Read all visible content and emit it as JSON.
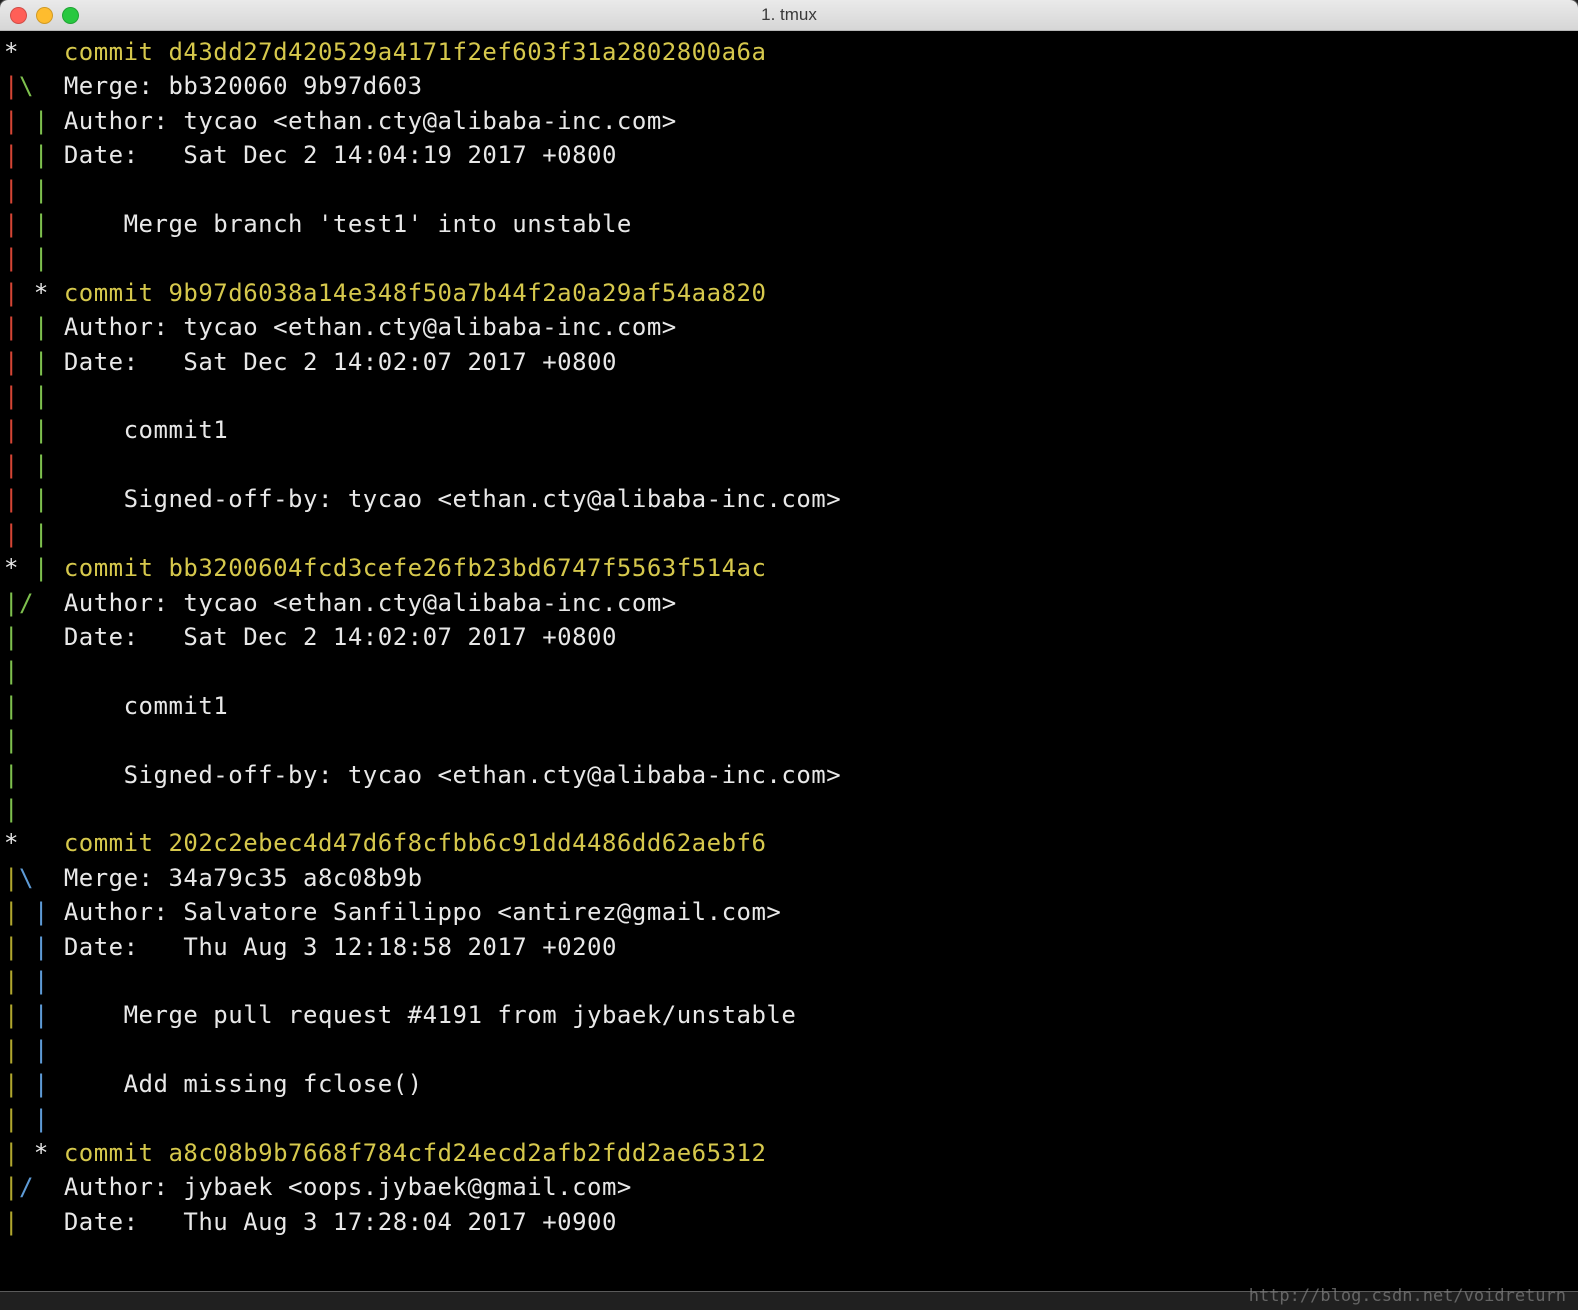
{
  "window": {
    "title": "1. tmux"
  },
  "watermark": "http://blog.csdn.net/voidreturn",
  "colors": {
    "red": "#d54535",
    "green": "#7ec04e",
    "yellow": "#d6c84c",
    "olive": "#b0a72e",
    "blue": "#5e9bd6",
    "white": "#e8e8e8"
  },
  "lines": [
    {
      "graph": [
        {
          "t": "*",
          "c": "white"
        },
        {
          "t": "   ",
          "c": "white"
        }
      ],
      "segs": [
        {
          "t": "commit d43dd27d420529a4171f2ef603f31a2802800a6a",
          "c": "yellow"
        }
      ]
    },
    {
      "graph": [
        {
          "t": "|",
          "c": "red"
        },
        {
          "t": "\\",
          "c": "green"
        },
        {
          "t": "  ",
          "c": "white"
        }
      ],
      "segs": [
        {
          "t": "Merge: bb320060 9b97d603",
          "c": "white"
        }
      ]
    },
    {
      "graph": [
        {
          "t": "|",
          "c": "red"
        },
        {
          "t": " ",
          "c": "white"
        },
        {
          "t": "|",
          "c": "green"
        },
        {
          "t": " ",
          "c": "white"
        }
      ],
      "segs": [
        {
          "t": "Author: tycao <ethan.cty@alibaba-inc.com>",
          "c": "white"
        }
      ]
    },
    {
      "graph": [
        {
          "t": "|",
          "c": "red"
        },
        {
          "t": " ",
          "c": "white"
        },
        {
          "t": "|",
          "c": "green"
        },
        {
          "t": " ",
          "c": "white"
        }
      ],
      "segs": [
        {
          "t": "Date:   Sat Dec 2 14:04:19 2017 +0800",
          "c": "white"
        }
      ]
    },
    {
      "graph": [
        {
          "t": "|",
          "c": "red"
        },
        {
          "t": " ",
          "c": "white"
        },
        {
          "t": "|",
          "c": "green"
        },
        {
          "t": " ",
          "c": "white"
        }
      ],
      "segs": []
    },
    {
      "graph": [
        {
          "t": "|",
          "c": "red"
        },
        {
          "t": " ",
          "c": "white"
        },
        {
          "t": "|",
          "c": "green"
        },
        {
          "t": " ",
          "c": "white"
        }
      ],
      "segs": [
        {
          "t": "    Merge branch 'test1' into unstable",
          "c": "white"
        }
      ]
    },
    {
      "graph": [
        {
          "t": "|",
          "c": "red"
        },
        {
          "t": " ",
          "c": "white"
        },
        {
          "t": "|",
          "c": "green"
        },
        {
          "t": " ",
          "c": "white"
        }
      ],
      "segs": []
    },
    {
      "graph": [
        {
          "t": "|",
          "c": "red"
        },
        {
          "t": " ",
          "c": "white"
        },
        {
          "t": "*",
          "c": "white"
        },
        {
          "t": " ",
          "c": "white"
        }
      ],
      "segs": [
        {
          "t": "commit 9b97d6038a14e348f50a7b44f2a0a29af54aa820",
          "c": "yellow"
        }
      ]
    },
    {
      "graph": [
        {
          "t": "|",
          "c": "red"
        },
        {
          "t": " ",
          "c": "white"
        },
        {
          "t": "|",
          "c": "green"
        },
        {
          "t": " ",
          "c": "white"
        }
      ],
      "segs": [
        {
          "t": "Author: tycao <ethan.cty@alibaba-inc.com>",
          "c": "white"
        }
      ]
    },
    {
      "graph": [
        {
          "t": "|",
          "c": "red"
        },
        {
          "t": " ",
          "c": "white"
        },
        {
          "t": "|",
          "c": "green"
        },
        {
          "t": " ",
          "c": "white"
        }
      ],
      "segs": [
        {
          "t": "Date:   Sat Dec 2 14:02:07 2017 +0800",
          "c": "white"
        }
      ]
    },
    {
      "graph": [
        {
          "t": "|",
          "c": "red"
        },
        {
          "t": " ",
          "c": "white"
        },
        {
          "t": "|",
          "c": "green"
        },
        {
          "t": " ",
          "c": "white"
        }
      ],
      "segs": []
    },
    {
      "graph": [
        {
          "t": "|",
          "c": "red"
        },
        {
          "t": " ",
          "c": "white"
        },
        {
          "t": "|",
          "c": "green"
        },
        {
          "t": " ",
          "c": "white"
        }
      ],
      "segs": [
        {
          "t": "    commit1",
          "c": "white"
        }
      ]
    },
    {
      "graph": [
        {
          "t": "|",
          "c": "red"
        },
        {
          "t": " ",
          "c": "white"
        },
        {
          "t": "|",
          "c": "green"
        },
        {
          "t": " ",
          "c": "white"
        }
      ],
      "segs": []
    },
    {
      "graph": [
        {
          "t": "|",
          "c": "red"
        },
        {
          "t": " ",
          "c": "white"
        },
        {
          "t": "|",
          "c": "green"
        },
        {
          "t": " ",
          "c": "white"
        }
      ],
      "segs": [
        {
          "t": "    Signed-off-by: tycao <ethan.cty@alibaba-inc.com>",
          "c": "white"
        }
      ]
    },
    {
      "graph": [
        {
          "t": "|",
          "c": "red"
        },
        {
          "t": " ",
          "c": "white"
        },
        {
          "t": "|",
          "c": "green"
        },
        {
          "t": " ",
          "c": "white"
        }
      ],
      "segs": []
    },
    {
      "graph": [
        {
          "t": "*",
          "c": "white"
        },
        {
          "t": " ",
          "c": "white"
        },
        {
          "t": "|",
          "c": "green"
        },
        {
          "t": " ",
          "c": "white"
        }
      ],
      "segs": [
        {
          "t": "commit bb3200604fcd3cefe26fb23bd6747f5563f514ac",
          "c": "yellow"
        }
      ]
    },
    {
      "graph": [
        {
          "t": "|",
          "c": "green"
        },
        {
          "t": "/",
          "c": "green"
        },
        {
          "t": "  ",
          "c": "white"
        }
      ],
      "segs": [
        {
          "t": "Author: tycao <ethan.cty@alibaba-inc.com>",
          "c": "white"
        }
      ]
    },
    {
      "graph": [
        {
          "t": "|",
          "c": "green"
        },
        {
          "t": "   ",
          "c": "white"
        }
      ],
      "segs": [
        {
          "t": "Date:   Sat Dec 2 14:02:07 2017 +0800",
          "c": "white"
        }
      ]
    },
    {
      "graph": [
        {
          "t": "|",
          "c": "green"
        },
        {
          "t": "   ",
          "c": "white"
        }
      ],
      "segs": []
    },
    {
      "graph": [
        {
          "t": "|",
          "c": "green"
        },
        {
          "t": "   ",
          "c": "white"
        }
      ],
      "segs": [
        {
          "t": "    commit1",
          "c": "white"
        }
      ]
    },
    {
      "graph": [
        {
          "t": "|",
          "c": "green"
        },
        {
          "t": "   ",
          "c": "white"
        }
      ],
      "segs": []
    },
    {
      "graph": [
        {
          "t": "|",
          "c": "green"
        },
        {
          "t": "   ",
          "c": "white"
        }
      ],
      "segs": [
        {
          "t": "    Signed-off-by: tycao <ethan.cty@alibaba-inc.com>",
          "c": "white"
        }
      ]
    },
    {
      "graph": [
        {
          "t": "|",
          "c": "green"
        },
        {
          "t": "   ",
          "c": "white"
        }
      ],
      "segs": []
    },
    {
      "graph": [
        {
          "t": "*",
          "c": "white"
        },
        {
          "t": "   ",
          "c": "white"
        }
      ],
      "segs": [
        {
          "t": "commit 202c2ebec4d47d6f8cfbb6c91dd4486dd62aebf6",
          "c": "yellow"
        }
      ]
    },
    {
      "graph": [
        {
          "t": "|",
          "c": "olive"
        },
        {
          "t": "\\",
          "c": "blue"
        },
        {
          "t": "  ",
          "c": "white"
        }
      ],
      "segs": [
        {
          "t": "Merge: 34a79c35 a8c08b9b",
          "c": "white"
        }
      ]
    },
    {
      "graph": [
        {
          "t": "|",
          "c": "olive"
        },
        {
          "t": " ",
          "c": "white"
        },
        {
          "t": "|",
          "c": "blue"
        },
        {
          "t": " ",
          "c": "white"
        }
      ],
      "segs": [
        {
          "t": "Author: Salvatore Sanfilippo <antirez@gmail.com>",
          "c": "white"
        }
      ]
    },
    {
      "graph": [
        {
          "t": "|",
          "c": "olive"
        },
        {
          "t": " ",
          "c": "white"
        },
        {
          "t": "|",
          "c": "blue"
        },
        {
          "t": " ",
          "c": "white"
        }
      ],
      "segs": [
        {
          "t": "Date:   Thu Aug 3 12:18:58 2017 +0200",
          "c": "white"
        }
      ]
    },
    {
      "graph": [
        {
          "t": "|",
          "c": "olive"
        },
        {
          "t": " ",
          "c": "white"
        },
        {
          "t": "|",
          "c": "blue"
        },
        {
          "t": " ",
          "c": "white"
        }
      ],
      "segs": []
    },
    {
      "graph": [
        {
          "t": "|",
          "c": "olive"
        },
        {
          "t": " ",
          "c": "white"
        },
        {
          "t": "|",
          "c": "blue"
        },
        {
          "t": " ",
          "c": "white"
        }
      ],
      "segs": [
        {
          "t": "    Merge pull request #4191 from jybaek/unstable",
          "c": "white"
        }
      ]
    },
    {
      "graph": [
        {
          "t": "|",
          "c": "olive"
        },
        {
          "t": " ",
          "c": "white"
        },
        {
          "t": "|",
          "c": "blue"
        },
        {
          "t": " ",
          "c": "white"
        }
      ],
      "segs": []
    },
    {
      "graph": [
        {
          "t": "|",
          "c": "olive"
        },
        {
          "t": " ",
          "c": "white"
        },
        {
          "t": "|",
          "c": "blue"
        },
        {
          "t": " ",
          "c": "white"
        }
      ],
      "segs": [
        {
          "t": "    Add missing fclose()",
          "c": "white"
        }
      ]
    },
    {
      "graph": [
        {
          "t": "|",
          "c": "olive"
        },
        {
          "t": " ",
          "c": "white"
        },
        {
          "t": "|",
          "c": "blue"
        },
        {
          "t": " ",
          "c": "white"
        }
      ],
      "segs": []
    },
    {
      "graph": [
        {
          "t": "|",
          "c": "olive"
        },
        {
          "t": " ",
          "c": "white"
        },
        {
          "t": "*",
          "c": "white"
        },
        {
          "t": " ",
          "c": "white"
        }
      ],
      "segs": [
        {
          "t": "commit a8c08b9b7668f784cfd24ecd2afb2fdd2ae65312",
          "c": "yellow"
        }
      ]
    },
    {
      "graph": [
        {
          "t": "|",
          "c": "olive"
        },
        {
          "t": "/",
          "c": "blue"
        },
        {
          "t": "  ",
          "c": "white"
        }
      ],
      "segs": [
        {
          "t": "Author: jybaek <oops.jybaek@gmail.com>",
          "c": "white"
        }
      ]
    },
    {
      "graph": [
        {
          "t": "|",
          "c": "olive"
        },
        {
          "t": "   ",
          "c": "white"
        }
      ],
      "segs": [
        {
          "t": "Date:   Thu Aug 3 17:28:04 2017 +0900",
          "c": "white"
        }
      ]
    }
  ]
}
